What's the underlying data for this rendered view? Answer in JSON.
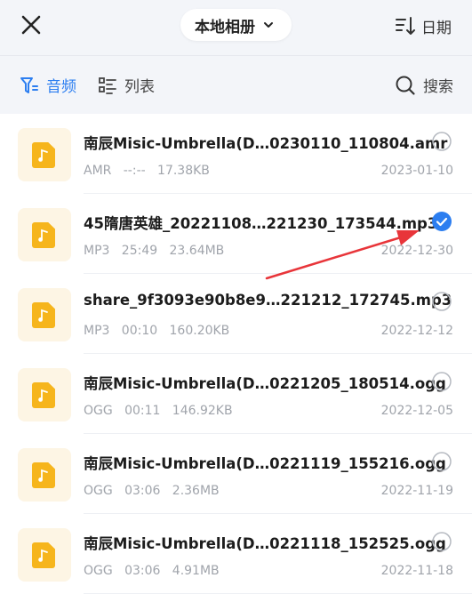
{
  "header": {
    "close_icon": "close-icon",
    "album_label": "本地相册",
    "sort_label": "日期",
    "sort_icon": "sort-icon"
  },
  "tabs": {
    "audio_label": "音频",
    "list_label": "列表",
    "search_label": "搜索"
  },
  "colors": {
    "accent": "#2c7ef0",
    "file_icon": "#f6b51c",
    "annotation_arrow": "#e8353a"
  },
  "files": [
    {
      "name": "南辰Misic-Umbrella(D…0230110_110804.amr",
      "format": "AMR",
      "duration": "--:--",
      "size": "17.38KB",
      "date": "2023-01-10",
      "selected": false
    },
    {
      "name": "45隋唐英雄_20221108…221230_173544.mp3",
      "format": "MP3",
      "duration": "25:49",
      "size": "23.64MB",
      "date": "2022-12-30",
      "selected": true
    },
    {
      "name": "share_9f3093e90b8e9…221212_172745.mp3",
      "format": "MP3",
      "duration": "00:10",
      "size": "160.20KB",
      "date": "2022-12-12",
      "selected": false
    },
    {
      "name": "南辰Misic-Umbrella(D…0221205_180514.ogg",
      "format": "OGG",
      "duration": "00:11",
      "size": "146.92KB",
      "date": "2022-12-05",
      "selected": false
    },
    {
      "name": "南辰Misic-Umbrella(D…0221119_155216.ogg",
      "format": "OGG",
      "duration": "03:06",
      "size": "2.36MB",
      "date": "2022-11-19",
      "selected": false
    },
    {
      "name": "南辰Misic-Umbrella(D…0221118_152525.ogg",
      "format": "OGG",
      "duration": "03:06",
      "size": "4.91MB",
      "date": "2022-11-18",
      "selected": false
    }
  ]
}
